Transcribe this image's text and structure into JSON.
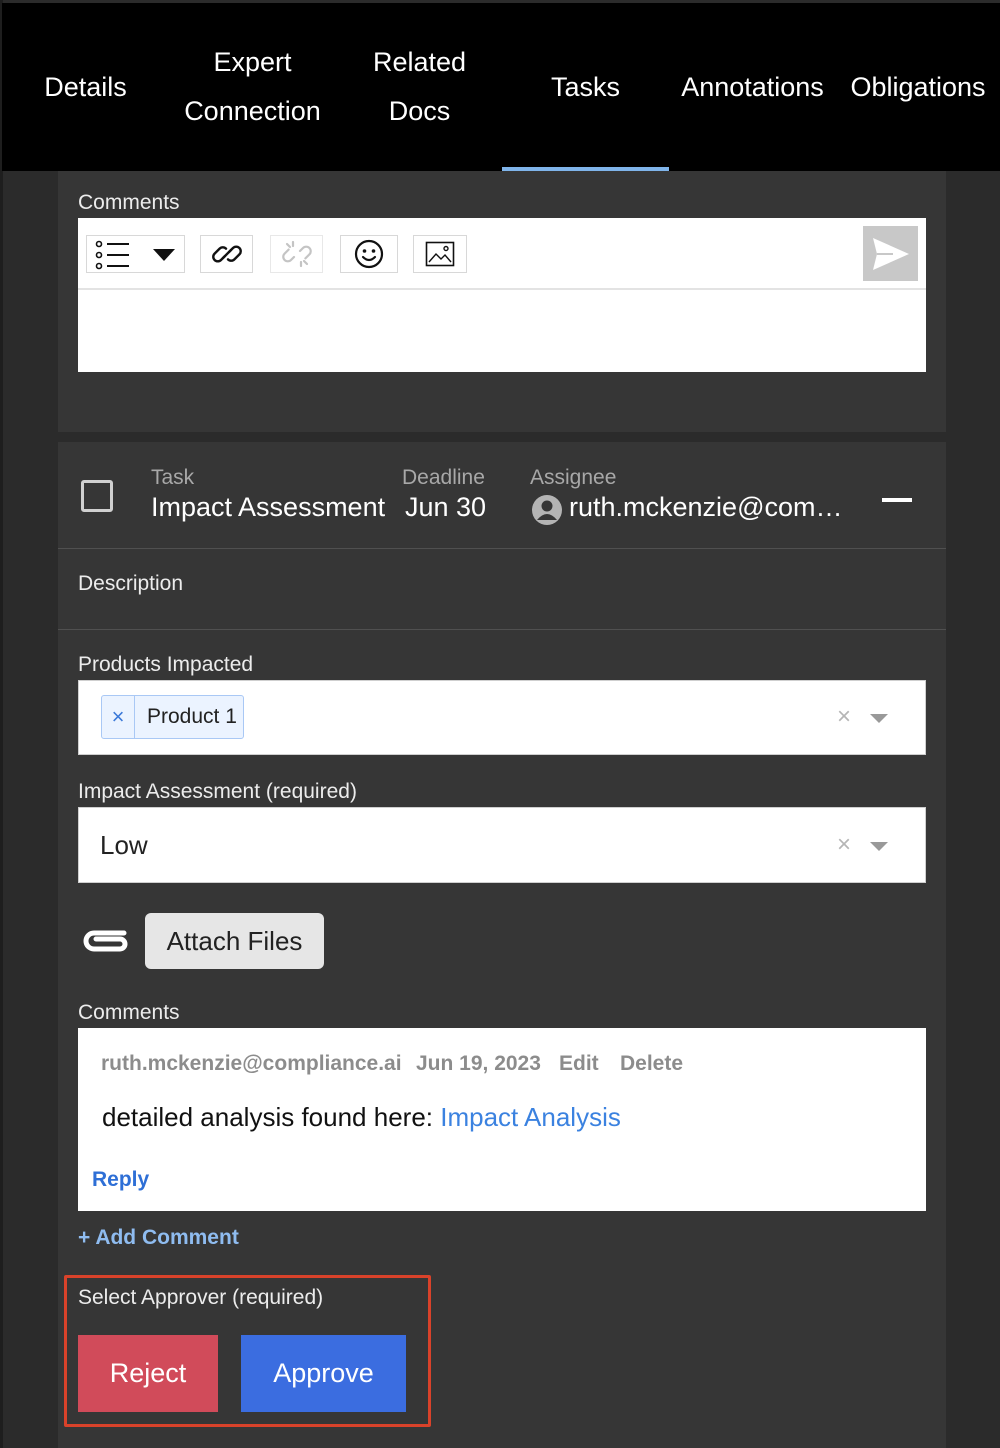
{
  "tabs": [
    {
      "line1": "Details",
      "line2": ""
    },
    {
      "line1": "Expert",
      "line2": "Connection"
    },
    {
      "line1": "Related",
      "line2": "Docs"
    },
    {
      "line1": "Tasks",
      "line2": ""
    },
    {
      "line1": "Annotations",
      "line2": ""
    },
    {
      "line1": "Obligations",
      "line2": ""
    }
  ],
  "active_tab": "Tasks",
  "top_comments": {
    "label": "Comments",
    "toolbar_icons": [
      "list-icon",
      "chevron-down-icon",
      "link-icon",
      "unlink-icon",
      "emoji-icon",
      "image-icon"
    ],
    "send_icon": "send-icon"
  },
  "task": {
    "col_task_label": "Task",
    "col_task_value": "Impact Assessment",
    "col_deadline_label": "Deadline",
    "col_deadline_value": "Jun 30",
    "col_assignee_label": "Assignee",
    "col_assignee_value": "ruth.mckenzie@com…",
    "description_label": "Description"
  },
  "products": {
    "label": "Products Impacted",
    "chip": "Product 1",
    "chip_remove": "×",
    "clear": "×"
  },
  "impact": {
    "label": "Impact Assessment (required)",
    "value": "Low",
    "clear": "×"
  },
  "attach": {
    "label": "Attach Files"
  },
  "comments": {
    "label": "Comments",
    "author": "ruth.mckenzie@compliance.ai",
    "date": "Jun 19, 2023",
    "edit": "Edit",
    "delete": "Delete",
    "text": "detailed analysis found here: ",
    "link_text": "Impact Analysis",
    "reply": "Reply",
    "add_comment": "+ Add Comment"
  },
  "approver": {
    "label": "Select Approver (required)",
    "reject": "Reject",
    "approve": "Approve"
  },
  "colors": {
    "tab_active": "#7fb4ea",
    "reject": "#d14b5a",
    "approve": "#3b6de0",
    "highlight_border": "#d9422a",
    "link": "#3b82e0"
  }
}
